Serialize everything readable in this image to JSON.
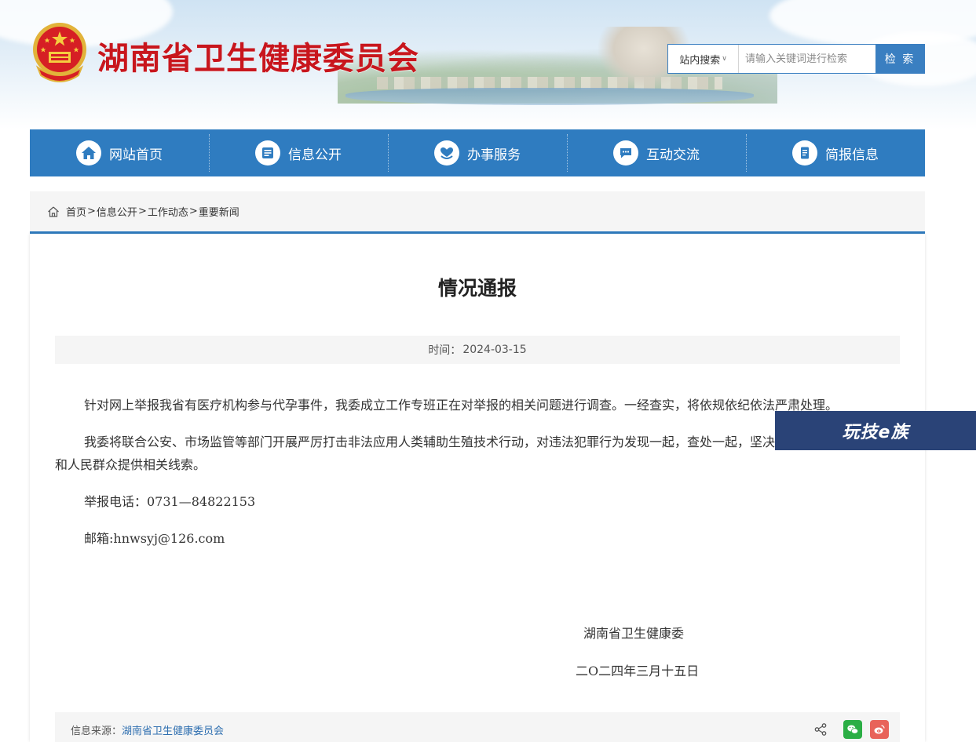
{
  "site": {
    "title": "湖南省卫生健康委员会"
  },
  "search": {
    "scope": "站内搜索",
    "placeholder": "请输入关键词进行检索",
    "button": "检 索"
  },
  "nav": {
    "items": [
      {
        "label": "网站首页",
        "icon": "home-icon"
      },
      {
        "label": "信息公开",
        "icon": "document-list-icon"
      },
      {
        "label": "办事服务",
        "icon": "heart-hands-icon"
      },
      {
        "label": "互动交流",
        "icon": "chat-bubble-icon"
      },
      {
        "label": "简报信息",
        "icon": "bulletin-icon"
      }
    ]
  },
  "breadcrumb": {
    "items": [
      "首页",
      "信息公开",
      "工作动态",
      "重要新闻"
    ],
    "separator": ">"
  },
  "article": {
    "title": "情况通报",
    "time_label": "时间：",
    "time_value": "2024-03-15",
    "paragraphs": [
      "针对网上举报我省有医疗机构参与代孕事件，我委成立工作专班正在对举报的相关问题进行调查。一经查实，将依规依纪依法严肃处理。",
      "我委将联合公安、市场监管等部门开展严厉打击非法应用人类辅助生殖技术行动，对违法犯罪行为发现一起，查处一起，坚决打击。欢迎新闻媒体和人民群众提供相关线索。",
      "举报电话：0731—84822153",
      "邮箱:hnwsyj@126.com"
    ],
    "signature_org": "湖南省卫生健康委",
    "signature_date": "二O二四年三月十五日",
    "source_label": "信息来源：",
    "source_value": "湖南省卫生健康委员会"
  },
  "share": {
    "icons": [
      "share-icon",
      "wechat-icon",
      "weibo-icon"
    ]
  },
  "watermark": {
    "text": "玩技e族"
  },
  "colors": {
    "brand_red": "#c8161d",
    "nav_blue": "#2f7cc0",
    "watermark_navy": "#2a4377"
  }
}
